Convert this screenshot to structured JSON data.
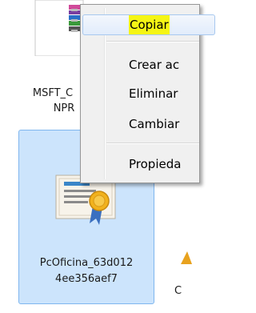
{
  "files": [
    {
      "label_line1": "MSFT_C",
      "label_line2": "NPR",
      "icon": "archive-icon"
    },
    {
      "label_line1": "PcOficina_63d012",
      "label_line2": "4ee356aef7",
      "icon": "certificate-icon"
    },
    {
      "label_line1": "C",
      "icon": "partial-file-icon"
    }
  ],
  "context_menu": {
    "items": [
      {
        "label": "Copiar"
      },
      {
        "label": "Crear ac"
      },
      {
        "label": "Eliminar"
      },
      {
        "label": "Cambiar"
      },
      {
        "label": "Propieda"
      }
    ]
  },
  "colors": {
    "selection_background": "#cce4fc",
    "selection_border": "#7fb6ef",
    "menu_background": "#f0f0f0",
    "highlight_text_background": "#f5f514"
  }
}
